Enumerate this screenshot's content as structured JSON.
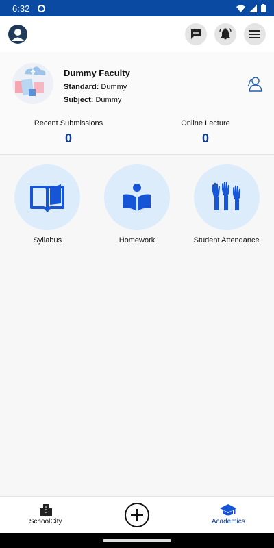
{
  "status_bar": {
    "time": "6:32"
  },
  "header": {
    "avatar_icon": "user-avatar-icon",
    "actions": [
      {
        "name": "chat",
        "icon": "chat-icon"
      },
      {
        "name": "notifications",
        "icon": "bell-icon"
      },
      {
        "name": "menu",
        "icon": "hamburger-icon"
      }
    ]
  },
  "profile": {
    "name": "Dummy Faculty",
    "standard_label": "Standard:",
    "standard_value": "Dummy",
    "subject_label": "Subject:",
    "subject_value": "Dummy"
  },
  "stats": {
    "recent_submissions": {
      "label": "Recent Submissions",
      "value": "0"
    },
    "online_lecture": {
      "label": "Online Lecture",
      "value": "0"
    }
  },
  "tiles": [
    {
      "label": "Syllabus",
      "icon": "open-book-icon"
    },
    {
      "label": "Homework",
      "icon": "reading-person-icon"
    },
    {
      "label": "Student Attendance",
      "icon": "raised-hands-icon"
    }
  ],
  "bottom_nav": {
    "home": {
      "label": "SchoolCity",
      "icon": "building-icon"
    },
    "add": {
      "icon": "plus-circle-icon"
    },
    "academics": {
      "label": "Academics",
      "icon": "graduation-cap-icon"
    }
  },
  "colors": {
    "status_bar": "#0b4aa2",
    "accent": "#0e3d97",
    "tile_bg": "#dcecfb",
    "icon_blue": "#1656d6"
  }
}
